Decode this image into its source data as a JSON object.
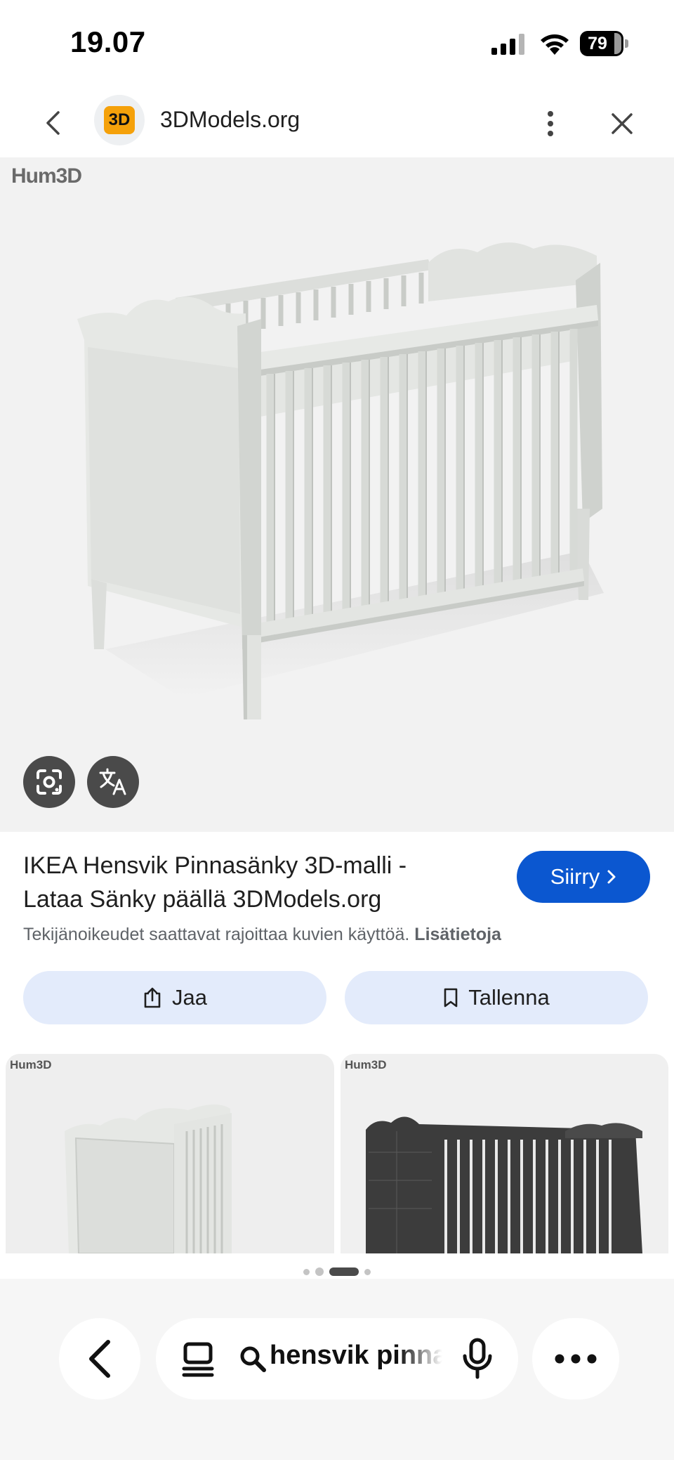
{
  "status_bar": {
    "time": "19.07",
    "battery": "79",
    "icons": [
      "signal-icon",
      "wifi-icon",
      "battery-icon"
    ]
  },
  "top_nav": {
    "site_logo_text": "3D",
    "site_name": "3DModels.org",
    "icons": [
      "back-icon",
      "more-vert-icon",
      "close-icon"
    ]
  },
  "image": {
    "watermark": "Hum3D",
    "overlay_buttons": [
      "lens-icon",
      "translate-icon"
    ]
  },
  "result": {
    "title": "IKEA Hensvik Pinnasänky 3D-malli - Lataa Sänky päällä 3DModels.org",
    "visit_label": "Siirry",
    "copyright_text": "Tekijänoikeudet saattavat rajoittaa kuvien käyttöä.",
    "learn_more": "Lisätietoja"
  },
  "actions": {
    "share_label": "Jaa",
    "save_label": "Tallenna"
  },
  "related": {
    "watermark": "Hum3D"
  },
  "bottom_bar": {
    "search_query": "hensvik pinnasänky",
    "icons": [
      "back-icon",
      "tabs-icon",
      "search-icon",
      "mic-icon",
      "more-horiz-icon"
    ]
  },
  "colors": {
    "accent": "#0b57d0",
    "chip_bg": "#e3ebfb",
    "image_bg": "#f2f2f2"
  }
}
